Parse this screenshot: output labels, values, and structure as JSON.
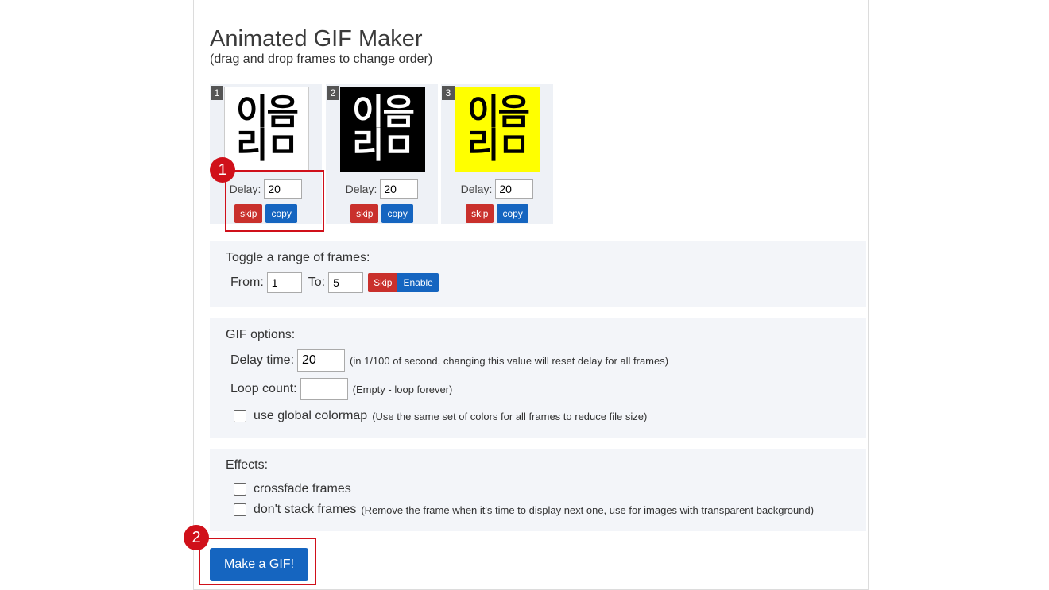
{
  "page": {
    "title": "Animated GIF Maker",
    "subtitle": "(drag and drop frames to change order)"
  },
  "frames": [
    {
      "number": "1",
      "glyph_top": "이음",
      "glyph_bottom": "리ㅁ",
      "theme": "white",
      "delay_label": "Delay:",
      "delay_value": "20",
      "skip_label": "skip",
      "copy_label": "copy"
    },
    {
      "number": "2",
      "glyph_top": "이음",
      "glyph_bottom": "리ㅁ",
      "theme": "black",
      "delay_label": "Delay:",
      "delay_value": "20",
      "skip_label": "skip",
      "copy_label": "copy"
    },
    {
      "number": "3",
      "glyph_top": "이음",
      "glyph_bottom": "리ㅁ",
      "theme": "yellow",
      "delay_label": "Delay:",
      "delay_value": "20",
      "skip_label": "skip",
      "copy_label": "copy"
    }
  ],
  "toggle_range": {
    "title": "Toggle a range of frames:",
    "from_label": "From:",
    "from_value": "1",
    "to_label": "To:",
    "to_value": "5",
    "skip_label": "Skip",
    "enable_label": "Enable"
  },
  "gif_options": {
    "title": "GIF options:",
    "delay_label": "Delay time:",
    "delay_value": "20",
    "delay_hint": "(in 1/100 of second, changing this value will reset delay for all frames)",
    "loop_label": "Loop count:",
    "loop_value": "",
    "loop_hint": "(Empty - loop forever)",
    "colormap_label": "use global colormap",
    "colormap_hint": "(Use the same set of colors for all frames to reduce file size)",
    "colormap_checked": false
  },
  "effects": {
    "title": "Effects:",
    "crossfade_label": "crossfade frames",
    "crossfade_checked": false,
    "nostack_label": "don't stack frames",
    "nostack_hint": "(Remove the frame when it's time to display next one, use for images with transparent background)",
    "nostack_checked": false
  },
  "make_button": "Make a GIF!",
  "annotations": {
    "marker_1": "1",
    "marker_2": "2"
  },
  "colors": {
    "skip": "#c9302c",
    "primary": "#1565c0",
    "highlight": "#d0101a",
    "section_bg": "#f3f5f9"
  }
}
